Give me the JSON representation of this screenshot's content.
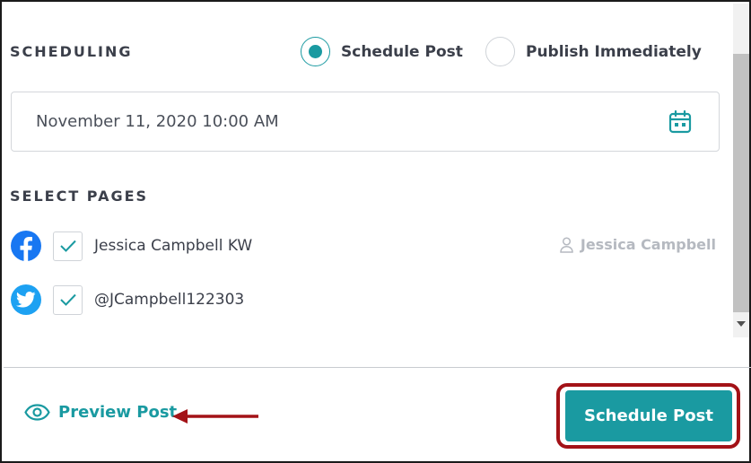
{
  "scheduling": {
    "section_label": "SCHEDULING",
    "options": [
      {
        "label": "Schedule Post",
        "selected": true
      },
      {
        "label": "Publish Immediately",
        "selected": false
      }
    ],
    "date_value": "November 11, 2020 10:00 AM",
    "date_icon": "calendar-icon"
  },
  "pages": {
    "section_label": "SELECT PAGES",
    "items": [
      {
        "platform": "facebook",
        "icon": "facebook-icon",
        "checked": true,
        "name": "Jessica Campbell KW",
        "owner": "Jessica Campbell"
      },
      {
        "platform": "twitter",
        "icon": "twitter-icon",
        "checked": true,
        "name": "@JCampbell122303"
      }
    ]
  },
  "footer": {
    "preview_label": "Preview Post",
    "schedule_label": "Schedule Post"
  },
  "colors": {
    "accent": "#1a9aa1",
    "highlight": "#a31217",
    "facebook": "#1877f2",
    "twitter": "#1da1f2"
  }
}
